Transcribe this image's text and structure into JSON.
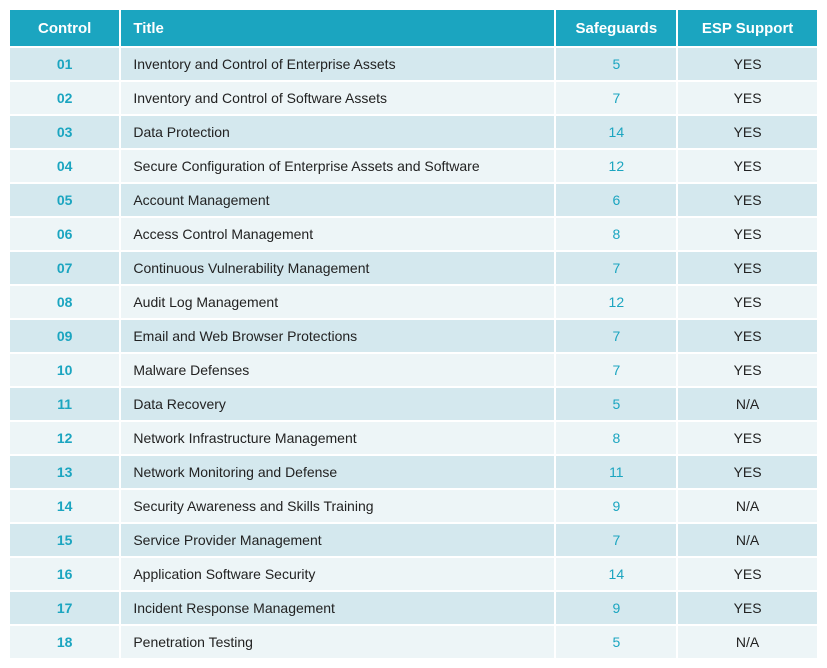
{
  "table": {
    "headers": {
      "control": "Control",
      "title": "Title",
      "safeguards": "Safeguards",
      "esp_support": "ESP Support"
    },
    "rows": [
      {
        "control": "01",
        "title": "Inventory and Control of Enterprise Assets",
        "safeguards": "5",
        "esp": "YES"
      },
      {
        "control": "02",
        "title": "Inventory and Control of Software Assets",
        "safeguards": "7",
        "esp": "YES"
      },
      {
        "control": "03",
        "title": "Data Protection",
        "safeguards": "14",
        "esp": "YES"
      },
      {
        "control": "04",
        "title": "Secure Configuration of Enterprise Assets and Software",
        "safeguards": "12",
        "esp": "YES"
      },
      {
        "control": "05",
        "title": "Account Management",
        "safeguards": "6",
        "esp": "YES"
      },
      {
        "control": "06",
        "title": "Access Control Management",
        "safeguards": "8",
        "esp": "YES"
      },
      {
        "control": "07",
        "title": "Continuous Vulnerability Management",
        "safeguards": "7",
        "esp": "YES"
      },
      {
        "control": "08",
        "title": "Audit Log Management",
        "safeguards": "12",
        "esp": "YES"
      },
      {
        "control": "09",
        "title": "Email and Web Browser Protections",
        "safeguards": "7",
        "esp": "YES"
      },
      {
        "control": "10",
        "title": "Malware Defenses",
        "safeguards": "7",
        "esp": "YES"
      },
      {
        "control": "11",
        "title": "Data Recovery",
        "safeguards": "5",
        "esp": "N/A"
      },
      {
        "control": "12",
        "title": "Network Infrastructure Management",
        "safeguards": "8",
        "esp": "YES"
      },
      {
        "control": "13",
        "title": "Network Monitoring and Defense",
        "safeguards": "11",
        "esp": "YES"
      },
      {
        "control": "14",
        "title": "Security Awareness and Skills Training",
        "safeguards": "9",
        "esp": "N/A"
      },
      {
        "control": "15",
        "title": "Service Provider Management",
        "safeguards": "7",
        "esp": "N/A"
      },
      {
        "control": "16",
        "title": "Application Software Security",
        "safeguards": "14",
        "esp": "YES"
      },
      {
        "control": "17",
        "title": "Incident Response Management",
        "safeguards": "9",
        "esp": "YES"
      },
      {
        "control": "18",
        "title": "Penetration Testing",
        "safeguards": "5",
        "esp": "N/A"
      }
    ]
  }
}
